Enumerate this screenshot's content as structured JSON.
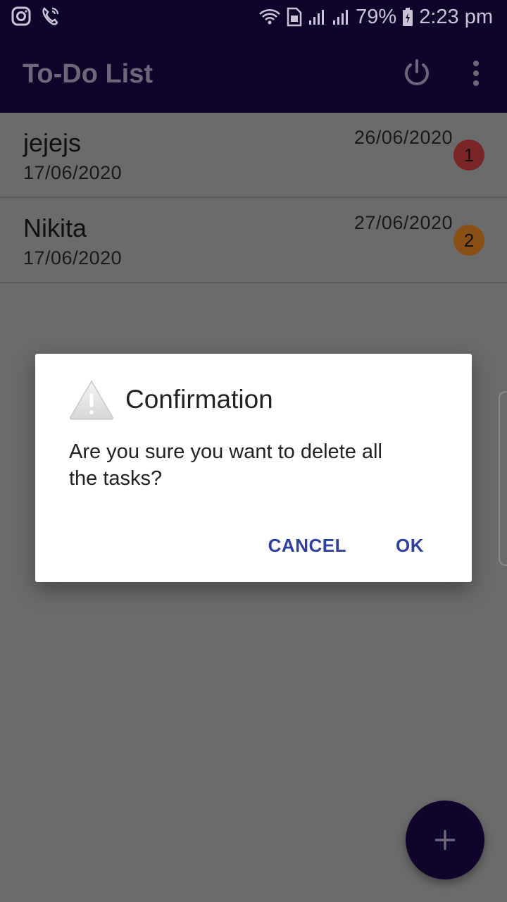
{
  "status_bar": {
    "battery": "79%",
    "time": "2:23 pm",
    "icons": [
      "instagram-icon",
      "wifi-call-icon",
      "wifi-icon",
      "sim-icon",
      "signal-icon",
      "signal-icon",
      "battery-icon"
    ]
  },
  "app_bar": {
    "title": "To-Do List",
    "icons": [
      "power-icon",
      "more-vert-icon"
    ]
  },
  "tasks": [
    {
      "name": "jejejs",
      "created": "17/06/2020",
      "due": "26/06/2020",
      "priority": "1",
      "badge_color": "#7a2626"
    },
    {
      "name": "Nikita",
      "created": "17/06/2020",
      "due": "27/06/2020",
      "priority": "2",
      "badge_color": "#8a4f15"
    }
  ],
  "dialog": {
    "icon": "warning-icon",
    "title": "Confirmation",
    "message": "Are you sure you want to delete all the tasks?",
    "cancel_label": "CANCEL",
    "ok_label": "OK"
  },
  "fab": {
    "icon": "plus-icon"
  },
  "colors": {
    "primary": "#10042b",
    "dialog_button": "#2f3f9e",
    "scrim_background": "#6b6b6b"
  }
}
